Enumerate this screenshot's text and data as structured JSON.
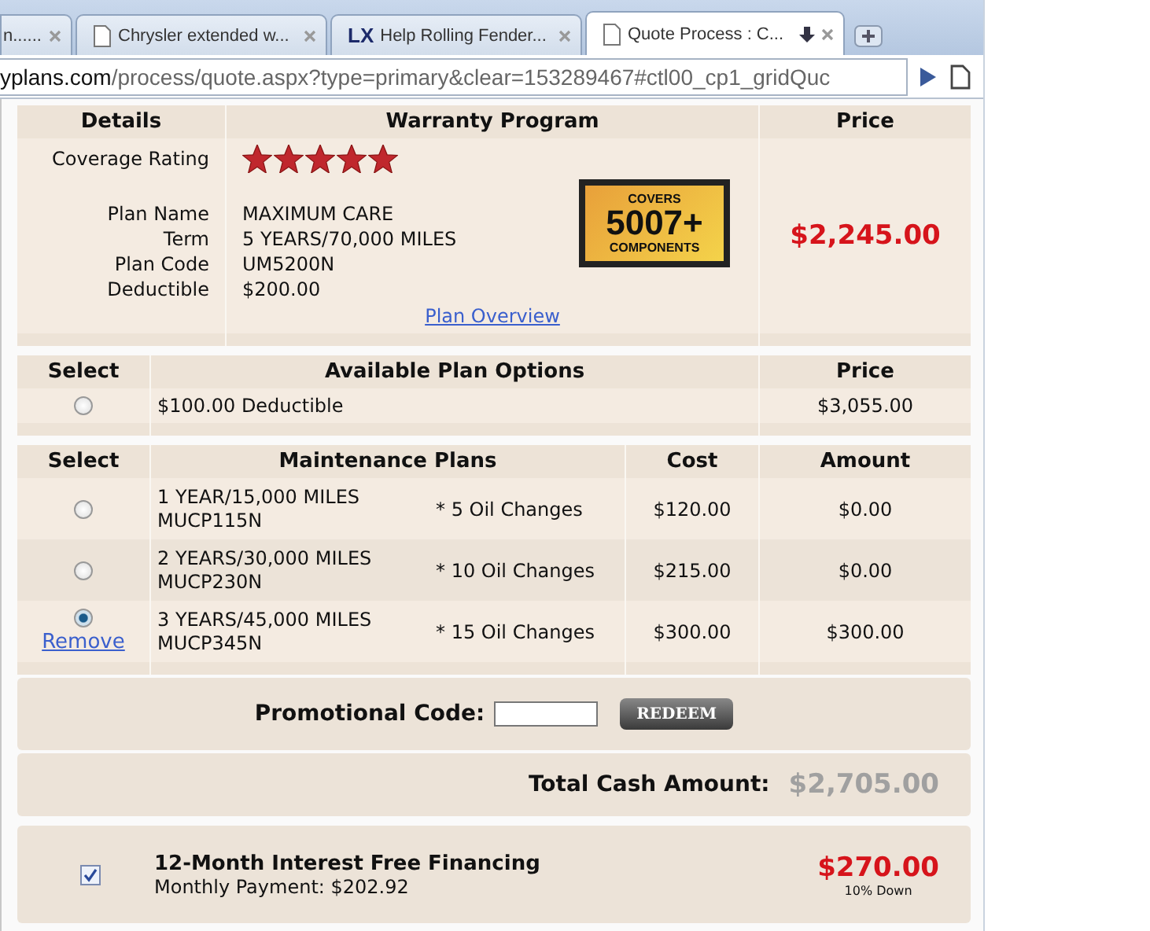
{
  "browser": {
    "tabs": [
      {
        "title": "n......",
        "kind": "plain",
        "selected": false
      },
      {
        "title": "Chrysler extended w...",
        "kind": "page",
        "selected": false
      },
      {
        "title": "Help Rolling Fender...",
        "kind": "logo",
        "favicon_text": "LX",
        "selected": false
      },
      {
        "title": "Quote Process : C...",
        "kind": "page",
        "selected": true
      }
    ],
    "address": {
      "domain": "yplans.com",
      "path": "/process/quote.aspx?type=primary&clear=153289467#ctl00_cp1_gridQuc"
    }
  },
  "plan": {
    "columns": [
      "Details",
      "Warranty Program",
      "Price"
    ],
    "rating_label": "Coverage Rating",
    "stars": 5,
    "fields": [
      {
        "label": "Plan Name",
        "value": "MAXIMUM CARE"
      },
      {
        "label": "Term",
        "value": "5 YEARS/70,000 MILES"
      },
      {
        "label": "Plan Code",
        "value": "UM5200N"
      },
      {
        "label": "Deductible",
        "value": "$200.00"
      }
    ],
    "badge": {
      "top": "COVERS",
      "number": "5007+",
      "bottom": "COMPONENTS"
    },
    "link": "Plan Overview",
    "price": "$2,245.00"
  },
  "options": {
    "columns": [
      "Select",
      "Available Plan Options",
      "Price"
    ],
    "rows": [
      {
        "selected": false,
        "name": "$100.00 Deductible",
        "price": "$3,055.00"
      }
    ]
  },
  "maintenance": {
    "columns": [
      "Select",
      "Maintenance Plans",
      "Cost",
      "Amount"
    ],
    "rows": [
      {
        "selected": false,
        "term": "1 YEAR/15,000 MILES",
        "code": "MUCP115N",
        "oil": "* 5 Oil Changes",
        "cost": "$120.00",
        "amount": "$0.00"
      },
      {
        "selected": false,
        "term": "2 YEARS/30,000 MILES",
        "code": "MUCP230N",
        "oil": "* 10 Oil Changes",
        "cost": "$215.00",
        "amount": "$0.00"
      },
      {
        "selected": true,
        "remove": "Remove",
        "term": "3 YEARS/45,000 MILES",
        "code": "MUCP345N",
        "oil": "* 15 Oil Changes",
        "cost": "$300.00",
        "amount": "$300.00"
      }
    ]
  },
  "promo": {
    "label": "Promotional Code:",
    "button": "REDEEM"
  },
  "total": {
    "label": "Total Cash Amount:",
    "value": "$2,705.00"
  },
  "financing": {
    "checked": true,
    "title": "12-Month Interest Free Financing",
    "payment": "Monthly Payment: $202.92",
    "down": "$270.00",
    "down_label": "10% Down"
  }
}
